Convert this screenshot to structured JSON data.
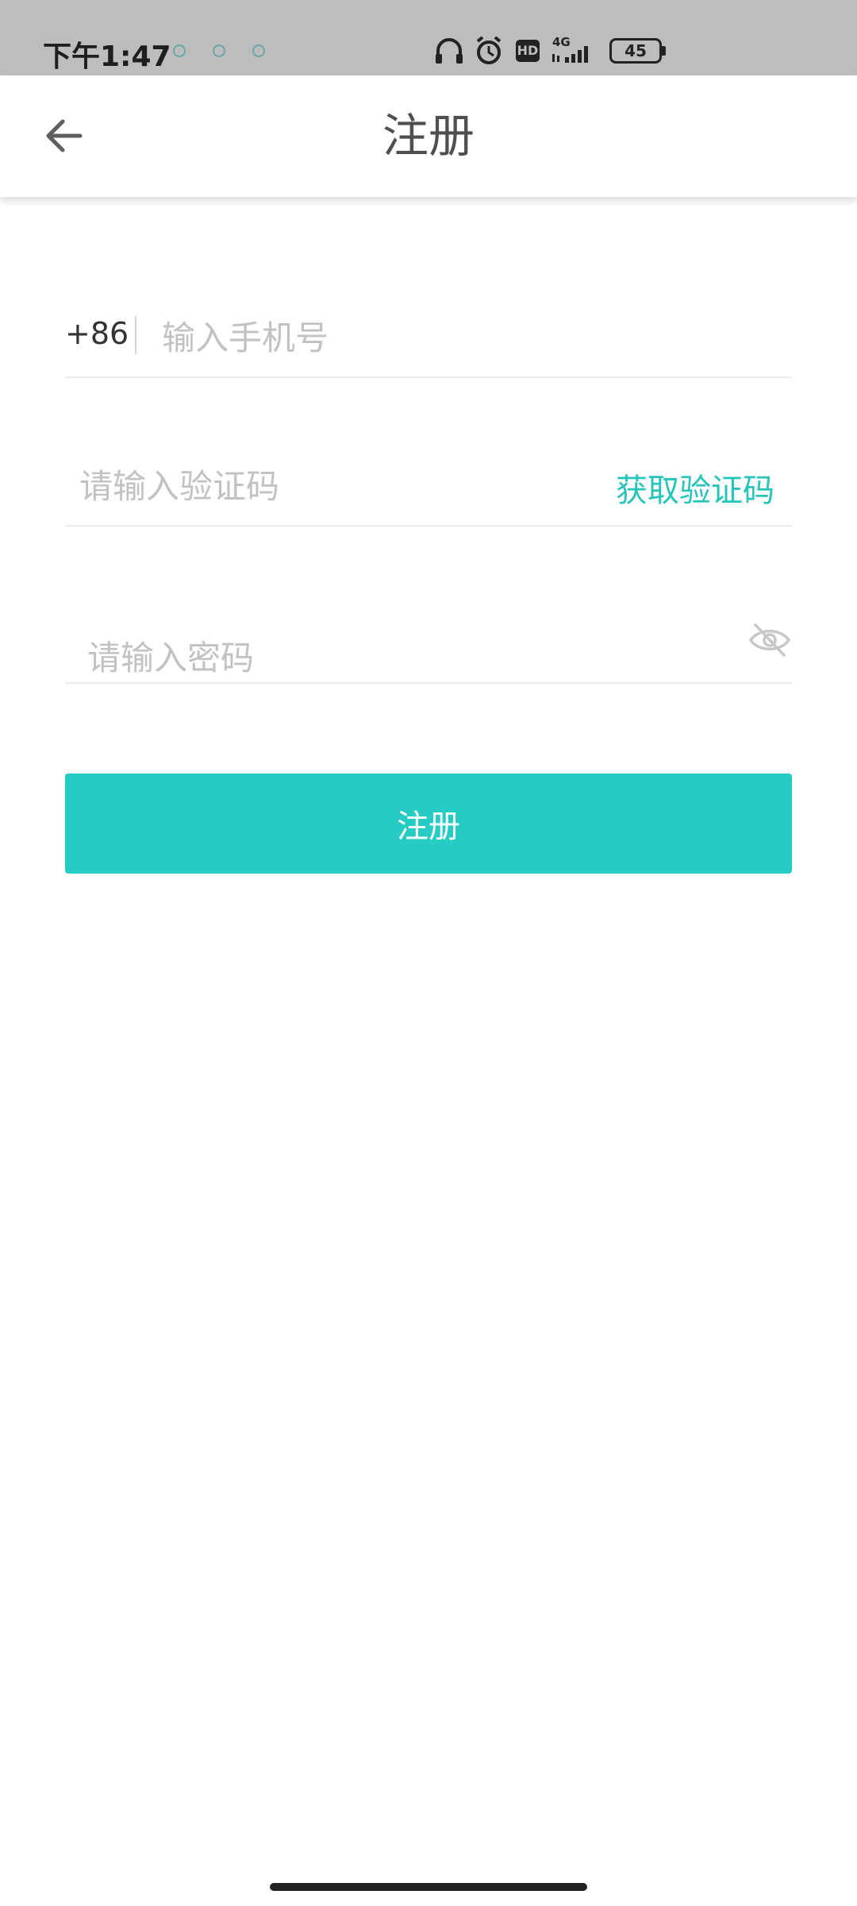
{
  "status_bar": {
    "time": "下午1:47",
    "network": "4G",
    "hd": "HD",
    "battery": "45"
  },
  "app_bar": {
    "title": "注册"
  },
  "form": {
    "phone": {
      "prefix": "+86",
      "placeholder": "输入手机号"
    },
    "code": {
      "placeholder": "请输入验证码",
      "get_code_label": "获取验证码"
    },
    "password": {
      "placeholder": "请输入密码"
    },
    "submit_label": "注册"
  },
  "colors": {
    "accent": "#26ccc3",
    "status_bar_bg": "#bdbdbd"
  }
}
